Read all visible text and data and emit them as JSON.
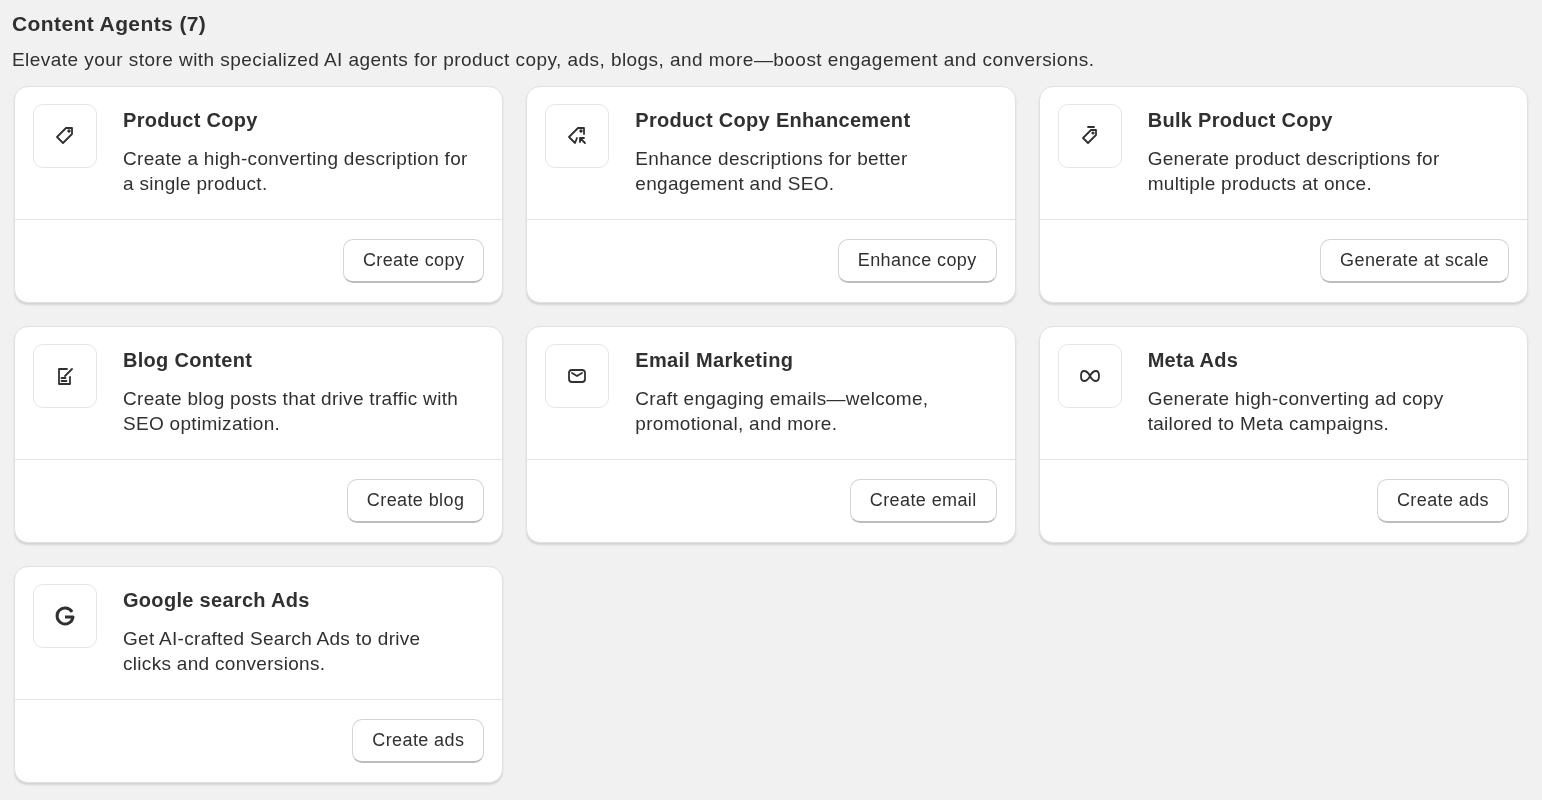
{
  "header": {
    "title": "Content Agents (7)",
    "subtitle": "Elevate your store with specialized AI agents for product copy, ads, blogs, and more—boost engagement and conversions."
  },
  "agents": [
    {
      "kind": "tag",
      "title": "Product Copy",
      "description": "Create a high-converting description for a single product.",
      "button": "Create copy"
    },
    {
      "kind": "tag-cursor",
      "title": "Product Copy Enhancement",
      "description": "Enhance descriptions for better engagement and SEO.",
      "button": "Enhance copy"
    },
    {
      "kind": "tags",
      "title": "Bulk Product Copy",
      "description": "Generate product descriptions for multiple products at once.",
      "button": "Generate at scale"
    },
    {
      "kind": "note-edit",
      "title": "Blog Content",
      "description": "Create blog posts that drive traffic with SEO optimization.",
      "button": "Create blog"
    },
    {
      "kind": "mail",
      "title": "Email Marketing",
      "description": "Craft engaging emails—welcome, promotional, and more.",
      "button": "Create email"
    },
    {
      "kind": "infinity",
      "title": "Meta Ads",
      "description": "Generate high-converting ad copy tailored to Meta campaigns.",
      "button": "Create ads"
    },
    {
      "kind": "letter-g",
      "title": "Google search Ads",
      "description": "Get AI-crafted Search Ads to drive clicks and conversions.",
      "button": "Create ads"
    }
  ]
}
